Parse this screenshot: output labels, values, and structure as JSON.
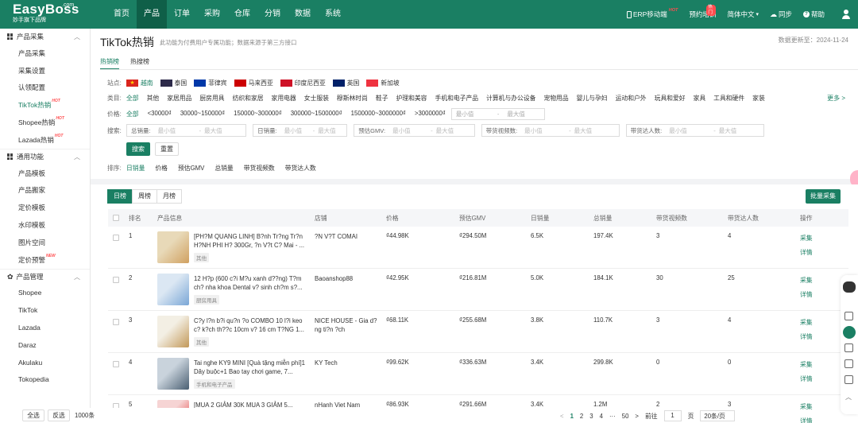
{
  "logo": {
    "brand": "EasyBoss",
    "com": ".com",
    "sub": "妙手旗下品牌"
  },
  "nav": [
    "首页",
    "产品",
    "订单",
    "采购",
    "仓库",
    "分销",
    "数据",
    "系统"
  ],
  "topright": {
    "erp": "ERP移动端",
    "hot": "HOT",
    "train": "预约培训",
    "train_badge": "热门",
    "lang": "简体中文",
    "sync": "同步",
    "help": "帮助"
  },
  "sidebar": {
    "sec1": "产品采集",
    "sec1_items": [
      {
        "label": "产品采集",
        "badge": ""
      },
      {
        "label": "采集设置",
        "badge": ""
      },
      {
        "label": "认领配置",
        "badge": ""
      },
      {
        "label": "TikTok热销",
        "badge": "HOT"
      },
      {
        "label": "Shopee热销",
        "badge": "HOT"
      },
      {
        "label": "Lazada热销",
        "badge": "HOT"
      }
    ],
    "sec2": "通用功能",
    "sec2_items": [
      {
        "label": "产品模板",
        "badge": ""
      },
      {
        "label": "产品搬家",
        "badge": ""
      },
      {
        "label": "定价模板",
        "badge": ""
      },
      {
        "label": "水印模板",
        "badge": ""
      },
      {
        "label": "图片空间",
        "badge": ""
      },
      {
        "label": "定价预警",
        "badge": "NEW"
      }
    ],
    "sec3": "产品管理",
    "sec3_items": [
      "Shopee",
      "TikTok",
      "Lazada",
      "Daraz",
      "Akulaku",
      "Tokopedia"
    ]
  },
  "header": {
    "title": "TikTok热销",
    "subtitle": "此功能为付费用户专属功能；数据来源于第三方接口",
    "update": "数据更新至：2024-11-24"
  },
  "tabs": [
    "热销榜",
    "热搜榜"
  ],
  "filters": {
    "site_label": "站点:",
    "sites": [
      {
        "name": "越南",
        "color": "#da251d"
      },
      {
        "name": "泰国",
        "color": "#2d2a4a"
      },
      {
        "name": "菲律宾",
        "color": "#0038a8"
      },
      {
        "name": "马来西亚",
        "color": "#cc0001"
      },
      {
        "name": "印度尼西亚",
        "color": "#ce1126"
      },
      {
        "name": "英国",
        "color": "#012169"
      },
      {
        "name": "新加坡",
        "color": "#ef3340"
      }
    ],
    "cat_label": "类目:",
    "cats": [
      "全部",
      "其他",
      "家居用品",
      "厨房用具",
      "纺织和家居",
      "家用电器",
      "女士服装",
      "穆斯林时尚",
      "鞋子",
      "护理和美容",
      "手机和电子产品",
      "计算机与办公设备",
      "宠物用品",
      "婴儿与孕妇",
      "运动和户外",
      "玩具和爱好",
      "家具",
      "工具和硬件",
      "家装"
    ],
    "more": "更多 >",
    "price_label": "价格:",
    "prices": [
      "全部",
      "<30000₫",
      "30000~150000₫",
      "150000~300000₫",
      "300000~1500000₫",
      "1500000~3000000₫",
      ">3000000₫"
    ],
    "min": "最小值",
    "max": "最大值",
    "dash": "-",
    "search_label": "搜索:",
    "search_fields": [
      "总销量:",
      "日销量:",
      "预估GMV:",
      "带货视频数:",
      "带货达人数:"
    ],
    "search_btn": "搜索",
    "reset_btn": "重置",
    "sort_label": "排序:",
    "sorts": [
      "日销量",
      "价格",
      "预估GMV",
      "总销量",
      "带货视频数",
      "带货达人数"
    ]
  },
  "period_tabs": [
    "日榜",
    "周榜",
    "月榜"
  ],
  "batch_btn": "批量采集",
  "columns": [
    "排名",
    "产品信息",
    "店铺",
    "价格",
    "预估GMV",
    "日销量",
    "总销量",
    "带货视频数",
    "带货达人数",
    "操作"
  ],
  "rows": [
    {
      "rank": "1",
      "name": "[PH?M QUANG LINH] B?nh Tr?ng Tr?n H?NH PHI H? 300Gr, ?n V?t C? Mai - ...",
      "cat": "其他",
      "store": "?N V?T COMAI",
      "price": "₫44.98K",
      "gmv": "₫294.50M",
      "daily": "6.5K",
      "total": "197.4K",
      "videos": "3",
      "creators": "4"
    },
    {
      "rank": "2",
      "name": "12 H?p (600 c?i M?u xanh d??ng) T?m ch? nha khoa Dental v? sinh ch?m s?...",
      "cat": "厨房用具",
      "store": "Baoanshop88",
      "price": "₫42.95K",
      "gmv": "₫216.81M",
      "daily": "5.0K",
      "total": "184.1K",
      "videos": "30",
      "creators": "25"
    },
    {
      "rank": "3",
      "name": "C?y l?n b?i qu?n ?o COMBO 10 l?i keo c? k?ch th??c 10cm v? 16 cm T?NG 1...",
      "cat": "其他",
      "store": "NICE HOUSE - Gia d?ng ti?n ?ch",
      "price": "₫68.11K",
      "gmv": "₫255.68M",
      "daily": "3.8K",
      "total": "110.7K",
      "videos": "3",
      "creators": "4"
    },
    {
      "rank": "4",
      "name": "Tai nghe KY9 MINI [Quà tặng miễn phí]1 Dây buộc+1 Bao tay chơi game, 7...",
      "cat": "手机和电子产品",
      "store": "KY Tech",
      "price": "₫99.62K",
      "gmv": "₫336.63M",
      "daily": "3.4K",
      "total": "299.8K",
      "videos": "0",
      "creators": "0"
    },
    {
      "rank": "5",
      "name": "[MUA 2 GIẢM 30K MUA 3 GIẢM 5...",
      "cat": "",
      "store": "nHanh Viet Nam",
      "price": "₫86.93K",
      "gmv": "₫291.66M",
      "daily": "3.4K",
      "total": "1.2M",
      "videos": "2",
      "creators": "3"
    }
  ],
  "row_actions": {
    "collect": "采集",
    "detail": "详情"
  },
  "footer": {
    "select_all": "全选",
    "invert": "反选",
    "count": "1000条",
    "prev": "<",
    "pages": [
      "1",
      "2",
      "3",
      "4",
      "···",
      "50"
    ],
    "next": ">",
    "goto": "前往",
    "page_value": "1",
    "page_unit": "页",
    "page_size": "20条/页"
  },
  "colors": {
    "primary": "#1a7f63",
    "hot": "#ff4d4f"
  }
}
